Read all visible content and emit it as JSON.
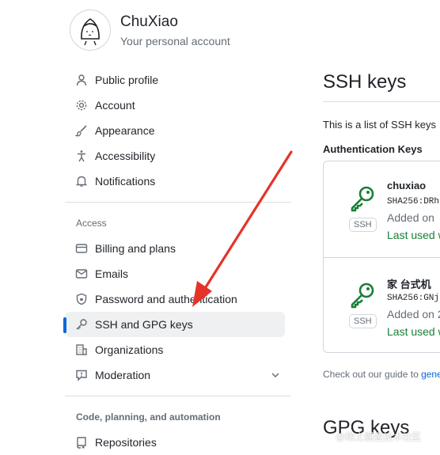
{
  "account": {
    "name": "ChuXiao",
    "subtitle": "Your personal account"
  },
  "sidebar": {
    "items_top": [
      {
        "label": "Public profile",
        "icon": "person-icon"
      },
      {
        "label": "Account",
        "icon": "gear-icon"
      },
      {
        "label": "Appearance",
        "icon": "paintbrush-icon"
      },
      {
        "label": "Accessibility",
        "icon": "accessibility-icon"
      },
      {
        "label": "Notifications",
        "icon": "bell-icon"
      }
    ],
    "access_header": "Access",
    "items_access": [
      {
        "label": "Billing and plans",
        "icon": "credit-card-icon"
      },
      {
        "label": "Emails",
        "icon": "mail-icon"
      },
      {
        "label": "Password and authentication",
        "icon": "shield-lock-icon"
      },
      {
        "label": "SSH and GPG keys",
        "icon": "key-icon",
        "active": true
      },
      {
        "label": "Organizations",
        "icon": "organization-icon"
      },
      {
        "label": "Moderation",
        "icon": "report-icon"
      }
    ],
    "code_header": "Code, planning, and automation",
    "items_code": [
      {
        "label": "Repositories",
        "icon": "repo-icon"
      }
    ]
  },
  "main": {
    "title": "SSH keys",
    "intro": "This is a list of SSH keys",
    "auth_header": "Authentication Keys",
    "keys": [
      {
        "title": "chuxiao",
        "fingerprint": "SHA256:DRh",
        "added": "Added on",
        "used": "Last used w",
        "badge": "SSH"
      },
      {
        "title": "家 台式机",
        "fingerprint": "SHA256:GNj",
        "added": "Added on 2",
        "used": "Last used w",
        "badge": "SSH"
      }
    ],
    "guide_prefix": "Check out our guide to ",
    "guide_link": "gene",
    "gpg_title": "GPG keys"
  },
  "watermark": "@稀土掘金技术社区",
  "colors": {
    "accent": "#0969da",
    "key_green": "#1a7f37",
    "arrow_red": "#e5332a"
  }
}
